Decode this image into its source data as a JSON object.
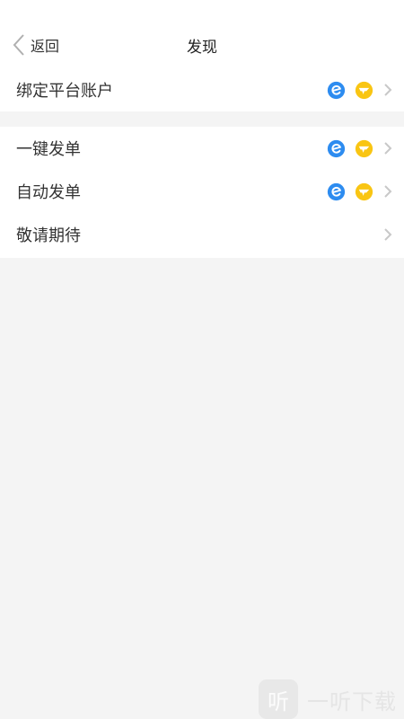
{
  "header": {
    "back_label": "返回",
    "title": "发现"
  },
  "groups": [
    {
      "rows": [
        {
          "label": "绑定平台账户",
          "icons": [
            "eleme-icon",
            "meituan-icon"
          ]
        }
      ]
    },
    {
      "rows": [
        {
          "label": "一键发单",
          "icons": [
            "eleme-icon",
            "meituan-icon"
          ]
        },
        {
          "label": "自动发单",
          "icons": [
            "eleme-icon",
            "meituan-icon"
          ]
        },
        {
          "label": "敬请期待",
          "icons": []
        }
      ]
    }
  ],
  "colors": {
    "eleme_blue": "#2d8cf0",
    "meituan_yellow": "#f9c513",
    "background": "#f4f4f4",
    "chevron": "#c8c8c8"
  },
  "watermark": {
    "icon_glyph": "听",
    "text": "一听下载"
  }
}
